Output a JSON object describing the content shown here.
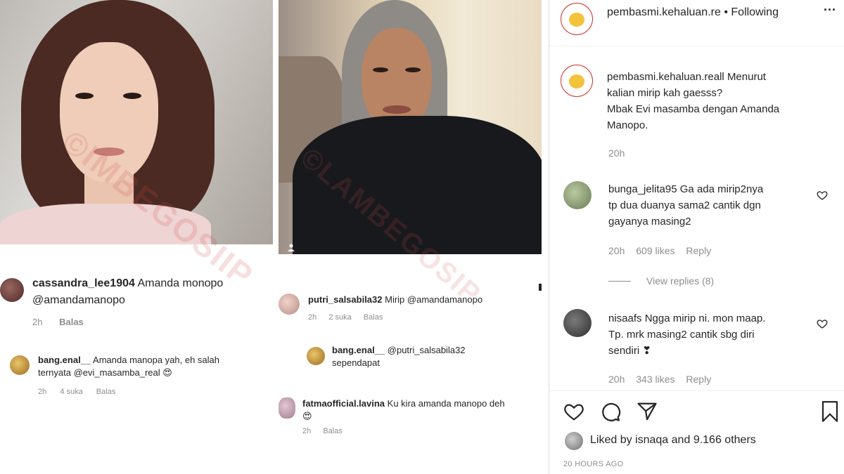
{
  "left": {
    "comment1": {
      "username": "cassandra_lee1904",
      "text": "Amanda monopo",
      "mention": "@amandamanopo",
      "time": "2h",
      "reply": "Balas"
    },
    "comment2": {
      "username": "bang.enal__",
      "text": "Amanda manopa yah, eh salah",
      "text2": "ternyata",
      "mention": "@evi_masamba_real",
      "emoji": "😍",
      "time": "2h",
      "likes": "4 suka",
      "reply": "Balas"
    }
  },
  "middle": {
    "comment1": {
      "username": "putri_salsabila32",
      "text": "Mirip",
      "mention": "@amandamanopo",
      "time": "2h",
      "likes": "2 suka",
      "reply": "Balas"
    },
    "comment2": {
      "username": "bang.enal__",
      "mention": "@putri_salsabila32",
      "text": "sependapat"
    },
    "comment3": {
      "username": "fatmaofficial.lavina",
      "text": "Ku kira amanda manopo deh",
      "emoji": "😍",
      "time": "2h",
      "reply": "Balas"
    }
  },
  "watermark": {
    "left": "©IMBEGOSIIP",
    "right": "©LAMBEGOSIP"
  },
  "sidebar": {
    "header": {
      "username": "pembasmi.kehaluan.re",
      "separator": "•",
      "follow_label": "Following",
      "more": "···"
    },
    "caption": {
      "username": "pembasmi.kehaluan.reall",
      "line1": "Menurut",
      "line2": "kalian mirip kah gaesss?",
      "line3": "Mbak Evi masamba dengan Amanda",
      "line4": "Manopo.",
      "time": "20h"
    },
    "comments": [
      {
        "username": "bunga_jelita95",
        "line1": "Ga ada mirip2nya",
        "line2": "tp dua duanya sama2 cantik dgn",
        "line3": "gayanya masing2",
        "time": "20h",
        "likes": "609 likes",
        "reply": "Reply",
        "view_replies": "View replies (8)"
      },
      {
        "username": "nisaafs",
        "line1": "Ngga mirip ni. mon maap.",
        "line2": "Tp. mrk masing2 cantik sbg diri",
        "line3": "sendiri ❣",
        "time": "20h",
        "likes": "343 likes",
        "reply": "Reply"
      }
    ],
    "liked_by": {
      "prefix": "Liked by",
      "user": "isnaqa",
      "middle": "and",
      "count": "9.166 others"
    },
    "timestamp": "20 HOURS AGO"
  },
  "icons": {
    "like": "heart-icon",
    "comment": "comment-icon",
    "share": "paper-plane-icon",
    "save": "bookmark-icon",
    "comment_like": "heart-outline-icon"
  }
}
